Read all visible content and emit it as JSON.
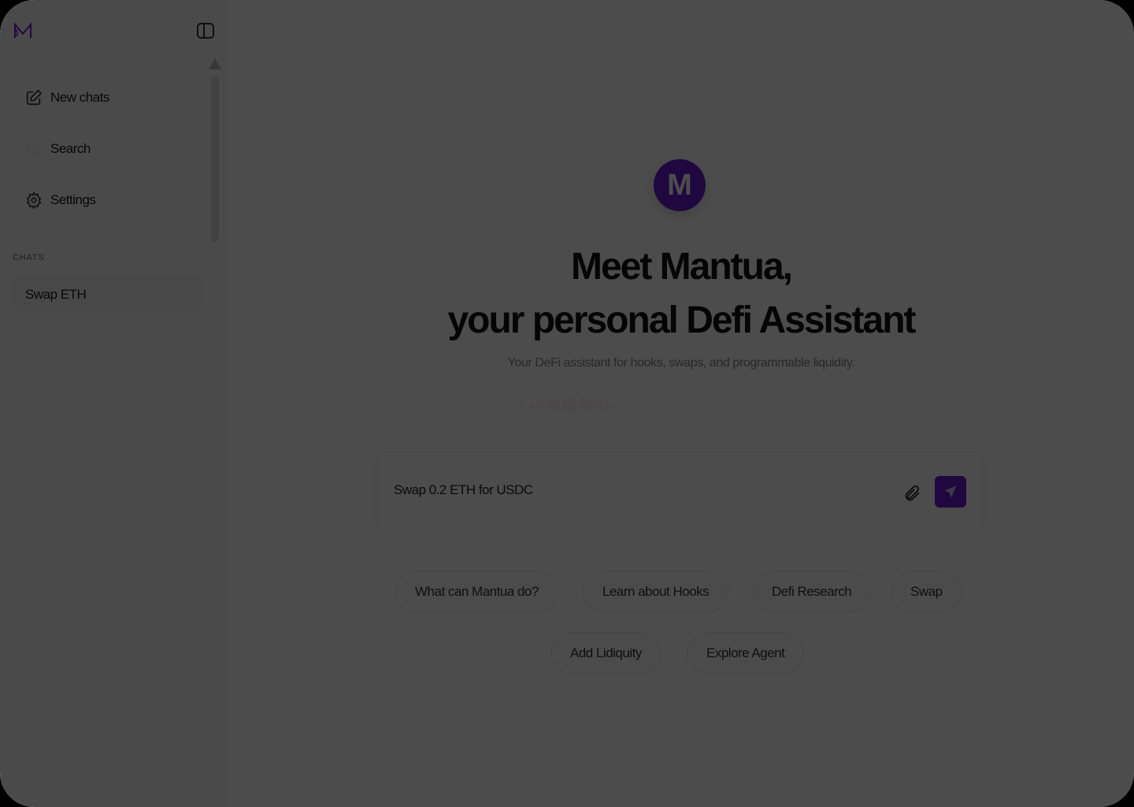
{
  "sidebar": {
    "logo": "M",
    "items": [
      {
        "label": "New chats",
        "icon": "edit-icon"
      },
      {
        "label": "Search",
        "icon": "search-icon"
      },
      {
        "label": "Settings",
        "icon": "gear-icon"
      }
    ],
    "chats_label": "CHATS",
    "chats": [
      {
        "label": "Swap ETH"
      }
    ]
  },
  "main": {
    "avatar_letter": "M",
    "title_line1": "Meet Mantua,",
    "title_line2": "your personal Defi Assistant",
    "subtitle": "Your DeFi assistant for hooks, swaps, and programmable liquidity.",
    "input_value": "Swap 0.2 ETH for USDC",
    "suggestions": [
      "What can Mantua do?",
      "Learn about Hooks",
      "Defi Research",
      "Swap",
      "Add Lidiquity",
      "Explore Agent"
    ]
  },
  "colors": {
    "brand": "#6a1bd8",
    "overlay": "rgba(0,0,0,0.7)"
  }
}
